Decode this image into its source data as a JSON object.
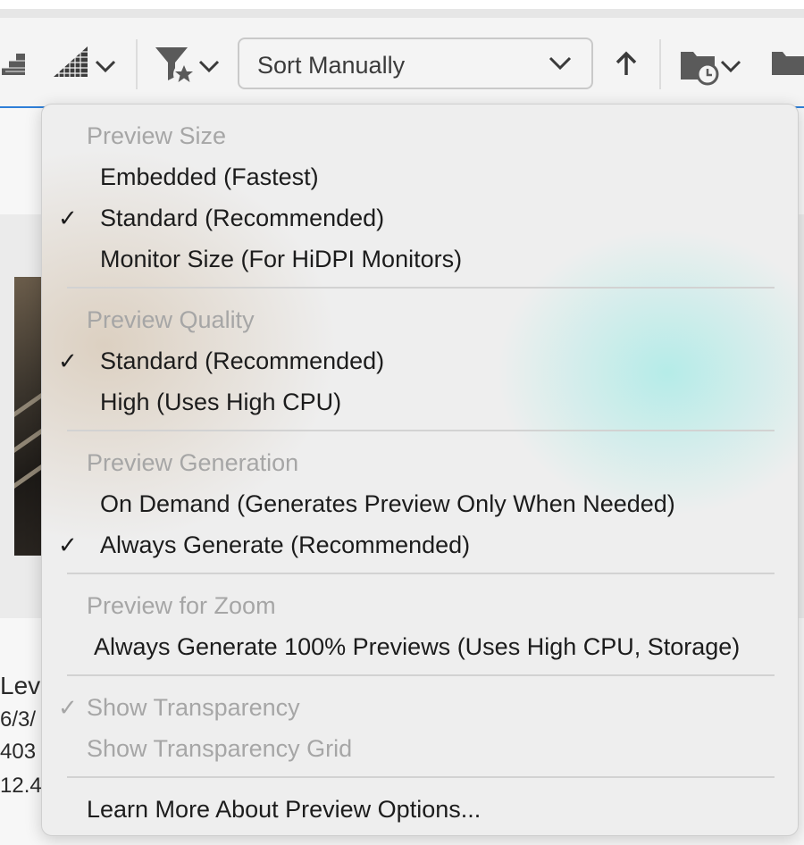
{
  "toolbar": {
    "sort": {
      "selected": "Sort Manually"
    }
  },
  "background_meta": {
    "line1": "Lev",
    "line2": "6/3/",
    "line3": "403",
    "line4": "12.4"
  },
  "menu": {
    "preview_size": {
      "heading": "Preview Size",
      "items": [
        {
          "label": "Embedded (Fastest)",
          "checked": false
        },
        {
          "label": "Standard (Recommended)",
          "checked": true
        },
        {
          "label": "Monitor Size (For HiDPI Monitors)",
          "checked": false
        }
      ]
    },
    "preview_quality": {
      "heading": "Preview Quality",
      "items": [
        {
          "label": "Standard (Recommended)",
          "checked": true
        },
        {
          "label": "High (Uses High CPU)",
          "checked": false
        }
      ]
    },
    "preview_generation": {
      "heading": "Preview Generation",
      "items": [
        {
          "label": "On Demand (Generates Preview Only When Needed)",
          "checked": false
        },
        {
          "label": "Always Generate (Recommended)",
          "checked": true
        }
      ]
    },
    "preview_zoom": {
      "heading": "Preview for Zoom",
      "items": [
        {
          "label": "Always Generate 100% Previews (Uses High CPU, Storage)",
          "checked": false
        }
      ]
    },
    "transparency": {
      "items": [
        {
          "label": "Show Transparency",
          "checked": true,
          "enabled": false
        },
        {
          "label": "Show Transparency Grid",
          "checked": false,
          "enabled": false
        }
      ]
    },
    "learn_more": "Learn More About Preview Options...",
    "check_glyph": "✓"
  },
  "colors": {
    "accent_line": "#2f7fd8",
    "menu_bg": "#eeeeee",
    "heading_text": "#a6a6a6",
    "item_text": "#1c1c1c"
  }
}
